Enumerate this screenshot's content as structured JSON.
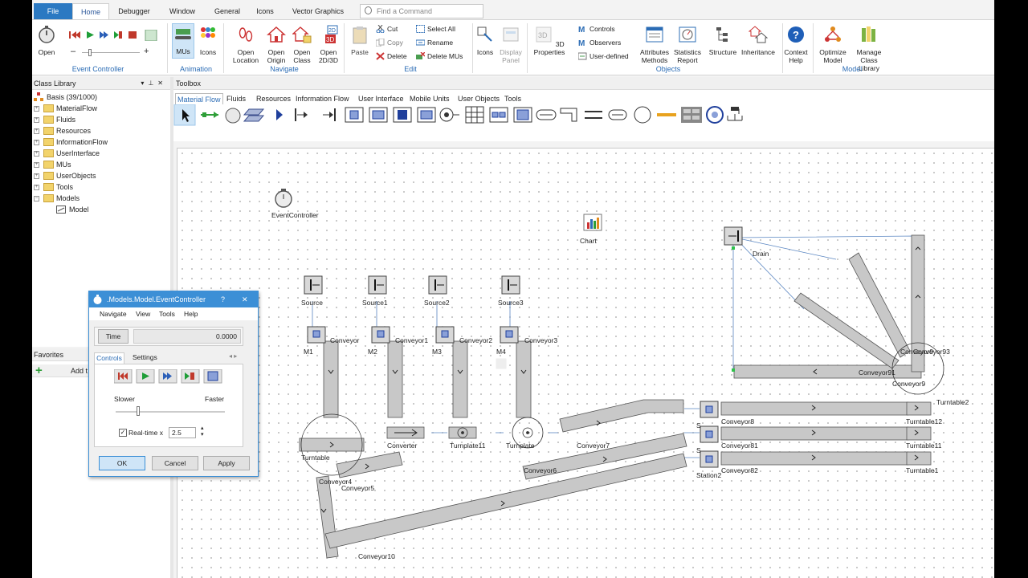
{
  "ribbon": {
    "tabs": [
      "File",
      "Home",
      "Debugger",
      "Window",
      "General",
      "Icons",
      "Vector Graphics"
    ],
    "active_tab": "Home",
    "search_placeholder": "Find a Command",
    "buttons": {
      "open": "Open",
      "open_location": "Open Location",
      "open_origin": "Open Origin",
      "open_class": "Open Class",
      "open_2d3d": "Open 2D/3D",
      "paste": "Paste",
      "cut": "Cut",
      "copy": "Copy",
      "delete": "Delete",
      "select_all": "Select All",
      "rename": "Rename",
      "delete_mus": "Delete MUs",
      "icons": "Icons",
      "display_panel": "Display Panel",
      "properties_3d": "3D Properties",
      "controls": "Controls",
      "observers": "Observers",
      "user_defined": "User-defined",
      "attributes_methods": "Attributes Methods",
      "statistics_report": "Statistics Report",
      "structure": "Structure",
      "inheritance": "Inheritance",
      "context_help": "Context Help",
      "optimize_model": "Optimize Model",
      "manage_class_library": "Manage Class Library",
      "mus": "MUs",
      "icons_anim": "Icons"
    },
    "groups": {
      "event_controller": "Event Controller",
      "animation": "Animation",
      "navigate": "Navigate",
      "edit": "Edit",
      "objects": "Objects",
      "model": "Model"
    }
  },
  "class_library": {
    "title": "Class Library",
    "root": "Basis (39/1000)",
    "items": [
      "MaterialFlow",
      "Fluids",
      "Resources",
      "InformationFlow",
      "UserInterface",
      "MUs",
      "UserObjects",
      "Tools",
      "Models"
    ],
    "child": "Model"
  },
  "favorites": {
    "title": "Favorites",
    "add": "Add t"
  },
  "toolbox": {
    "title": "Toolbox",
    "tabs": [
      "Material Flow",
      "Fluids",
      "Resources",
      "Information Flow",
      "User Interface",
      "Mobile Units",
      "User Objects",
      "Tools"
    ],
    "active_tab": "Material Flow"
  },
  "canvas": {
    "labels": {
      "event_controller": "EventController",
      "chart": "Chart",
      "drain": "Drain",
      "source": "Source",
      "source1": "Source1",
      "source2": "Source2",
      "source3": "Source3",
      "m1": "M1",
      "m2": "M2",
      "m3": "M3",
      "m4": "M4",
      "conveyor": "Conveyor",
      "conveyor1": "Conveyor1",
      "conveyor2": "Conveyor2",
      "conveyor3": "Conveyor3",
      "turntable": "Turntable",
      "converter": "Converter",
      "turnplate11": "Turnplate11",
      "turnplate": "Turnplate",
      "conveyor7": "Conveyor7",
      "conveyor6": "Conveyor6",
      "conveyor5": "Conveyor5",
      "conveyor4": "Conveyor4",
      "conveyor10": "Conveyor10",
      "conveyor8": "Conveyor8",
      "conveyor81": "Conveyor81",
      "conveyor82": "Conveyor82",
      "turntable12": "Turntable12",
      "turntable11": "Turntable11",
      "turntable1": "Turntable1",
      "station2": "Station2",
      "station_s1": "S",
      "station_s2": "S",
      "conveyor9": "Conveyor9",
      "conveyor91": "Conveyor91",
      "conveyor93": "Conveyor93",
      "conveyor92": "Conveyor9",
      "turntable2": "Turntable2"
    }
  },
  "dialog": {
    "title": ".Models.Model.EventController",
    "help": "?",
    "close": "✕",
    "menu": [
      "Navigate",
      "View",
      "Tools",
      "Help"
    ],
    "time_label": "Time",
    "time_value": "0.0000",
    "tabs": [
      "Controls",
      "Settings"
    ],
    "slower": "Slower",
    "faster": "Faster",
    "speed_fraction": 0.2,
    "realtime_label": "Real-time x",
    "realtime_checked": true,
    "realtime_value": "2.5",
    "ok": "OK",
    "cancel": "Cancel",
    "apply": "Apply"
  }
}
